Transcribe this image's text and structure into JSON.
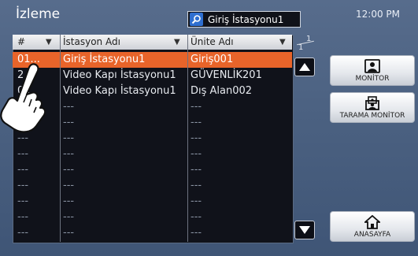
{
  "header": {
    "title": "İzleme",
    "search_value": "Giriş İstasyonu1",
    "clock": "12:00 PM"
  },
  "table": {
    "columns": [
      "#",
      "İstasyon Adı",
      "Ünite Adı"
    ],
    "rows": [
      {
        "num": "01...",
        "station": "Giriş İstasyonu1",
        "unit": "Giriş001",
        "selected": true
      },
      {
        "num": "2...",
        "station": "Video Kapı İstasyonu1",
        "unit": "GÜVENLİK201",
        "selected": false
      },
      {
        "num": "0...",
        "station": "Video Kapı İstasyonu1",
        "unit": "Dış Alan002",
        "selected": false
      },
      {
        "num": "---",
        "station": "---",
        "unit": "---",
        "selected": false
      },
      {
        "num": "---",
        "station": "---",
        "unit": "---",
        "selected": false
      },
      {
        "num": "---",
        "station": "---",
        "unit": "---",
        "selected": false
      },
      {
        "num": "---",
        "station": "---",
        "unit": "---",
        "selected": false
      },
      {
        "num": "---",
        "station": "---",
        "unit": "---",
        "selected": false
      },
      {
        "num": "---",
        "station": "---",
        "unit": "---",
        "selected": false
      },
      {
        "num": "---",
        "station": "---",
        "unit": "---",
        "selected": false
      },
      {
        "num": "---",
        "station": "---",
        "unit": "---",
        "selected": false
      },
      {
        "num": "---",
        "station": "---",
        "unit": "---",
        "selected": false
      }
    ]
  },
  "pager": {
    "current": "1",
    "total": "1"
  },
  "buttons": {
    "monitor": "MONİTOR",
    "scan_monitor": "TARAMA MONİTOR",
    "home": "ANASAYFA"
  },
  "colors": {
    "background": "#4b6181",
    "selected_row": "#e8642a",
    "search_icon": "#2f6fd0"
  },
  "icons": [
    "search-icon",
    "sort-arrow-icon",
    "scroll-up-icon",
    "scroll-down-icon",
    "monitor-icon",
    "scan-monitor-icon",
    "home-icon",
    "pointing-hand-icon"
  ]
}
